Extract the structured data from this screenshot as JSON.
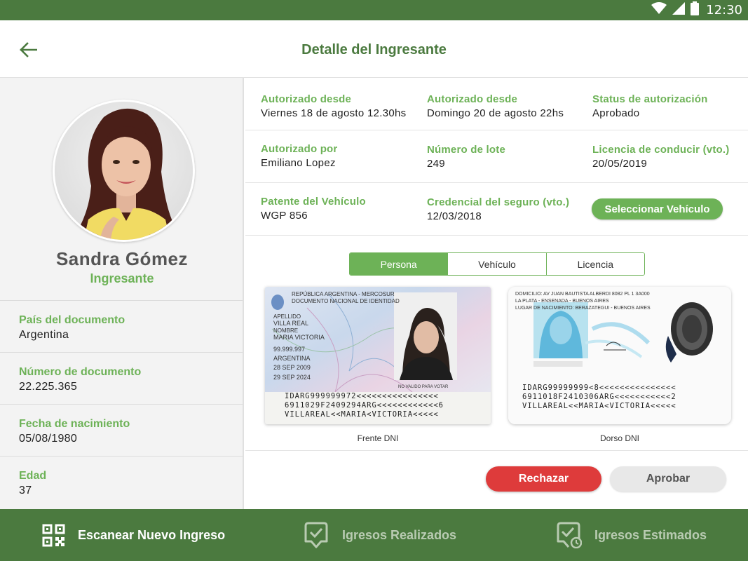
{
  "status_bar": {
    "time": "12:30"
  },
  "app_bar": {
    "title": "Detalle del Ingresante"
  },
  "person": {
    "name": "Sandra Gómez",
    "role": "Ingresante",
    "fields": [
      {
        "label": "País del documento",
        "value": "Argentina"
      },
      {
        "label": "Número de documento",
        "value": "22.225.365"
      },
      {
        "label": "Fecha de nacimiento",
        "value": "05/08/1980"
      },
      {
        "label": "Edad",
        "value": "37"
      }
    ]
  },
  "details": {
    "row1": [
      {
        "label": "Autorizado desde",
        "value": "Viernes 18 de agosto 12.30hs"
      },
      {
        "label": "Autorizado desde",
        "value": "Domingo 20 de agosto 22hs"
      },
      {
        "label": "Status de autorización",
        "value": "Aprobado"
      }
    ],
    "row2": [
      {
        "label": "Autorizado por",
        "value": "Emiliano Lopez"
      },
      {
        "label": "Número de lote",
        "value": "249"
      },
      {
        "label": "Licencia de conducir (vto.)",
        "value": "20/05/2019"
      }
    ],
    "row3": [
      {
        "label": "Patente del Vehículo",
        "value": "WGP 856"
      },
      {
        "label": "Credencial del seguro (vto.)",
        "value": "12/03/2018"
      }
    ],
    "select_vehicle_label": "Seleccionar Vehículo"
  },
  "tabs": [
    {
      "label": "Persona",
      "active": true
    },
    {
      "label": "Vehículo",
      "active": false
    },
    {
      "label": "Licencia",
      "active": false
    }
  ],
  "documents": {
    "front": {
      "caption": "Frente DNI",
      "header_text": "REPÚBLICA ARGENTINA - MERCOSUR\nDOCUMENTO NACIONAL DE IDENTIDAD",
      "surname_label": "APELLIDO",
      "surname": "VILLA REAL",
      "name_label": "NOMBRE",
      "name": "MARIA VICTORIA",
      "doc_number": "99.999.997",
      "nationality": "ARGENTINA",
      "issue_date": "28 SEP 2009",
      "expiry_date": "29 SEP 2024",
      "not_valid_text": "NO VALIDO PARA VOTAR",
      "mrz": "IDARG999999972<<<<<<<<<<<<<<<<\n6911029F2409294ARG<<<<<<<<<<<<6\nVILLAREAL<<MARIA<VICTORIA<<<<<"
    },
    "back": {
      "caption": "Dorso DNI",
      "address_text": "DOMICILIO: AV JUAN BAUTISTA ALBERDI 8082 PL 1 3A000\nLA PLATA - ENSENADA - BUENOS AIRES\nLUGAR DE NACIMIENTO: BERAZATEGUI - BUENOS AIRES",
      "mrz": "IDARG99999999<8<<<<<<<<<<<<<<<\n6911018F2410306ARG<<<<<<<<<<<2\nVILLAREAL<<MARIA<VICTORIA<<<<<"
    }
  },
  "actions": {
    "reject_label": "Rechazar",
    "approve_label": "Aprobar"
  },
  "bottom_nav": [
    {
      "label": "Escanear Nuevo Ingreso",
      "icon": "qr-code-icon",
      "active": true
    },
    {
      "label": "Igresos Realizados",
      "icon": "checklist-icon",
      "active": false
    },
    {
      "label": "Igresos Estimados",
      "icon": "clock-list-icon",
      "active": false
    }
  ],
  "colors": {
    "primary_dark": "#4b7a3f",
    "accent_green": "#6db257",
    "reject_red": "#de3b3b",
    "approve_gray": "#e8e8e8"
  }
}
